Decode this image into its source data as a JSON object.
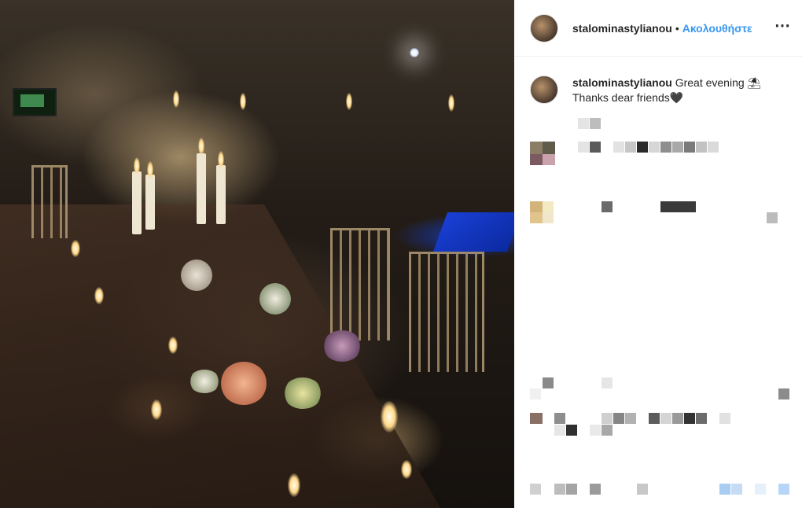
{
  "post": {
    "username": "stalominastylianou",
    "separator": "•",
    "follow_label": "Ακολουθήστε",
    "more_icon": "⋯"
  },
  "caption": {
    "username": "stalominastylianou",
    "line1": "Great evening ⛱",
    "line2": "Thanks dear friends🖤"
  },
  "colors": {
    "follow": "#3897f0",
    "divider": "#efefef"
  }
}
